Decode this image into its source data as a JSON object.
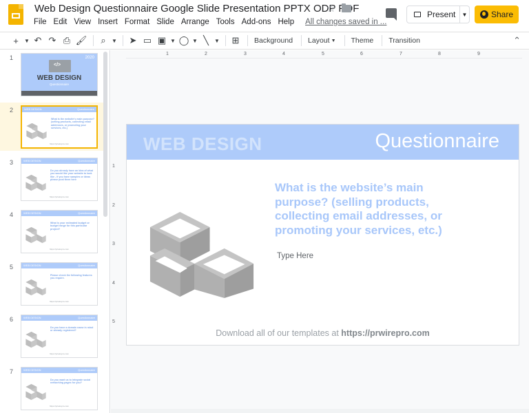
{
  "doc": {
    "title": "Web Design Questionnaire Google Slide Presentation PPTX ODP PDF",
    "status": "All changes saved in ..."
  },
  "menu": [
    "File",
    "Edit",
    "View",
    "Insert",
    "Format",
    "Slide",
    "Arrange",
    "Tools",
    "Add-ons",
    "Help"
  ],
  "header": {
    "present_label": "Present",
    "share_label": "Share"
  },
  "toolbar": {
    "background_label": "Background",
    "layout_label": "Layout",
    "theme_label": "Theme",
    "transition_label": "Transition"
  },
  "colors": {
    "accent": "#fbbc04",
    "slide_band": "#aecbfa",
    "question": "#a8c7fa"
  },
  "thumbnails": [
    {
      "num": "1",
      "year": "2020",
      "heading": "WEB DESIGN",
      "sub": "Questionnaire"
    },
    {
      "num": "2",
      "band_left": "WEB DESIGN",
      "band_right": "Questionnaire",
      "question": "What is the website's main purpose? (selling products, collecting email addresses, or promoting your services, etc.)"
    },
    {
      "num": "3",
      "band_left": "WEB DESIGN",
      "band_right": "Questionnaire",
      "question": "Do you already have an idea of what you would like your website to look like - if you have samples or ideas please post them here"
    },
    {
      "num": "4",
      "band_left": "WEB DESIGN",
      "band_right": "Questionnaire",
      "question": "What is your estimated budget or budget range for this particular project?"
    },
    {
      "num": "5",
      "band_left": "WEB DESIGN",
      "band_right": "Questionnaire",
      "question": "Please check the following features you require."
    },
    {
      "num": "6",
      "band_left": "WEB DESIGN",
      "band_right": "Questionnaire",
      "question": "Do you have a domain name in mind or already registered?"
    },
    {
      "num": "7",
      "band_left": "WEB DESIGN",
      "band_right": "Questionnaire",
      "question": "Do you want us to integrate social networking pages for you?"
    }
  ],
  "slide": {
    "band_left": "WEB DESIGN",
    "band_right": "Questionnaire",
    "question": "What is the website’s main purpose? (selling products, collecting email addresses, or promoting your services, etc.)",
    "type_here": "Type Here",
    "footer_prefix": "Download all of our templates at ",
    "footer_link": "https://prwirepro.com"
  },
  "ruler": {
    "h": [
      "1",
      "2",
      "3",
      "4",
      "5",
      "6",
      "7",
      "8",
      "9"
    ],
    "v": [
      "1",
      "2",
      "3",
      "4",
      "5"
    ]
  }
}
